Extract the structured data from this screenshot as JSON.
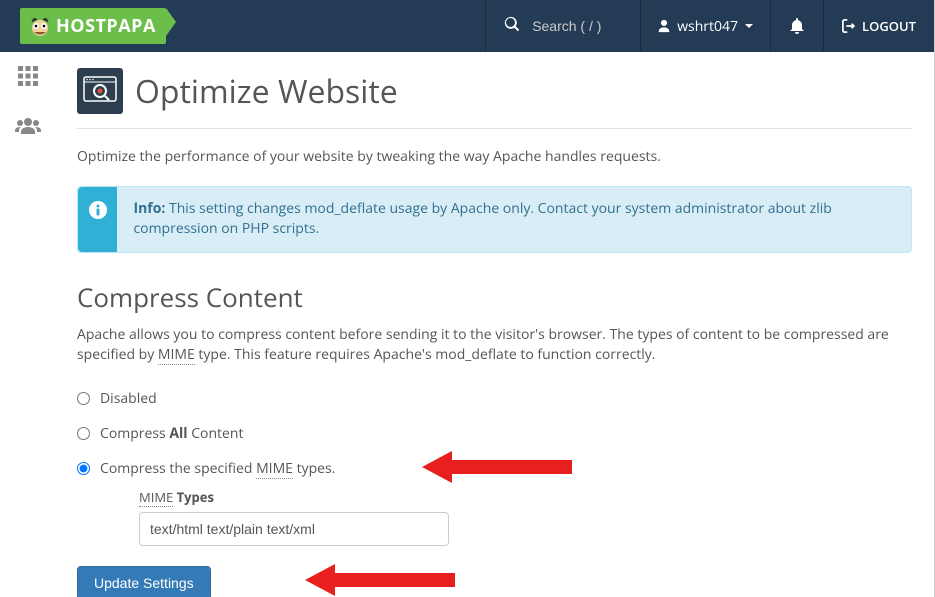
{
  "header": {
    "brand": "HOSTPAPA",
    "search_placeholder": "Search ( / )",
    "username": "wshrt047",
    "logout_label": "LOGOUT"
  },
  "page": {
    "title": "Optimize Website",
    "intro": "Optimize the performance of your website by tweaking the way Apache handles requests.",
    "info_label": "Info:",
    "info_text": " This setting changes mod_deflate usage by Apache only. Contact your system administrator about zlib compression on PHP scripts."
  },
  "compress": {
    "title": "Compress Content",
    "desc_pre": "Apache allows you to compress content before sending it to the visitor's browser. The types of content to be compressed are specified by ",
    "desc_mime": "MIME",
    "desc_post": " type. This feature requires Apache's mod_deflate to function correctly.",
    "options": {
      "disabled": "Disabled",
      "all_pre": "Compress ",
      "all_bold": "All",
      "all_post": " Content",
      "specified_pre": "Compress the specified ",
      "specified_mime": "MIME",
      "specified_post": " types."
    },
    "mime_label_underline": "MIME",
    "mime_label_bold": " Types",
    "mime_value": "text/html text/plain text/xml",
    "update_button": "Update Settings"
  }
}
